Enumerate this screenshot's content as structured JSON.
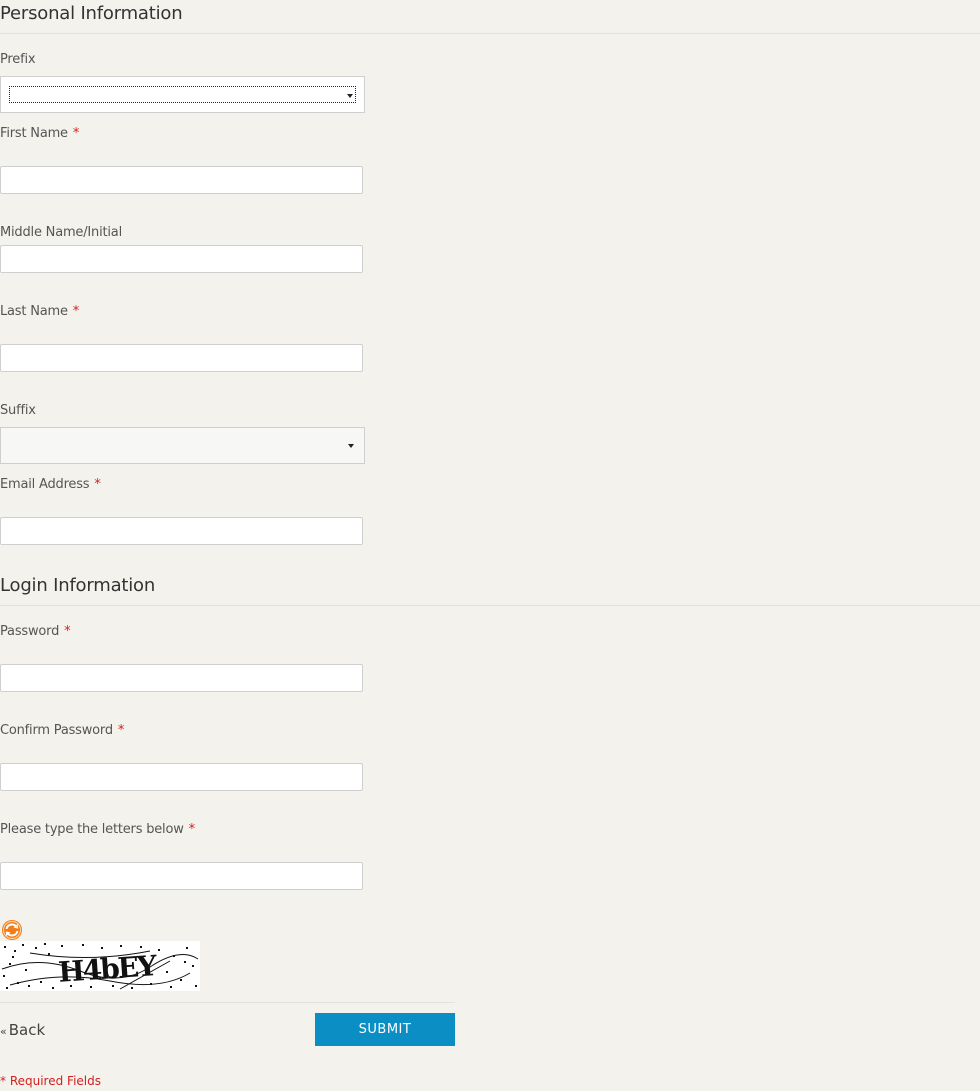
{
  "personal": {
    "title": "Personal Information",
    "prefix_label": "Prefix",
    "prefix_value": "",
    "first_name_label": "First Name",
    "first_name_value": "",
    "middle_name_label": "Middle Name/Initial",
    "middle_name_value": "",
    "last_name_label": "Last Name",
    "last_name_value": "",
    "suffix_label": "Suffix",
    "suffix_value": "",
    "email_label": "Email Address",
    "email_value": ""
  },
  "login": {
    "title": "Login Information",
    "password_label": "Password",
    "password_value": "",
    "confirm_password_label": "Confirm Password",
    "confirm_password_value": "",
    "captcha_label": "Please type the letters below",
    "captcha_value": "",
    "captcha_image_text": "H4bEY",
    "refresh_icon": "refresh-icon"
  },
  "required_mark": "*",
  "actions": {
    "back_arrow": "«",
    "back_label": "Back",
    "submit_label": "SUBMIT"
  },
  "footer": {
    "required_note": "* Required Fields"
  },
  "colors": {
    "background": "#f4f2ed",
    "accent": "#0a8ec4",
    "required": "#d21f1f",
    "refresh": "#f07d18"
  }
}
